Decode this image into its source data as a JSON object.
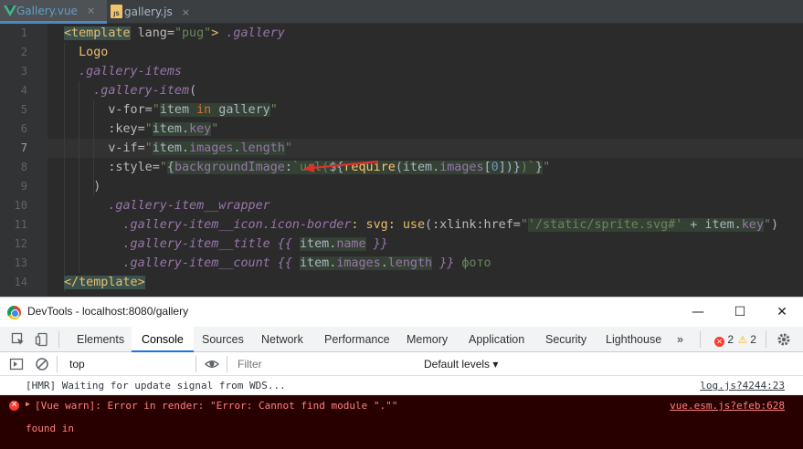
{
  "editor": {
    "tabs": [
      {
        "label": "Gallery.vue",
        "active": true,
        "icon": "vue-icon"
      },
      {
        "label": "gallery.js",
        "active": false,
        "icon": "js-icon"
      }
    ],
    "close_glyph": "×",
    "line_numbers": [
      "1",
      "2",
      "3",
      "4",
      "5",
      "6",
      "7",
      "8",
      "9",
      "10",
      "11",
      "12",
      "13",
      "14"
    ],
    "current_line": 7,
    "accent": "#4a88c7",
    "annotation_arrow_color": "#e0302a"
  },
  "devtools": {
    "window_title": "DevTools - localhost:8080/gallery",
    "window_controls": {
      "minimize": "—",
      "maximize": "☐",
      "close": "✕"
    },
    "panels": [
      "Elements",
      "Console",
      "Sources",
      "Network",
      "Performance",
      "Memory",
      "Application",
      "Security",
      "Lighthouse"
    ],
    "active_panel": "Console",
    "more_panels": "»",
    "error_count": "2",
    "warning_count": "2",
    "context": "top",
    "filter_placeholder": "Filter",
    "levels": "Default levels ▾",
    "messages": [
      {
        "type": "info",
        "text": "[HMR] Waiting for update signal from WDS...",
        "source": "log.js?4244:23"
      },
      {
        "type": "error",
        "text": "[Vue warn]: Error in render: \"Error: Cannot find module \".\"\"",
        "source": "vue.esm.js?efeb:628",
        "detail": "found in"
      }
    ],
    "error_color": "#ff3b30",
    "warning_color": "#f4b400"
  }
}
